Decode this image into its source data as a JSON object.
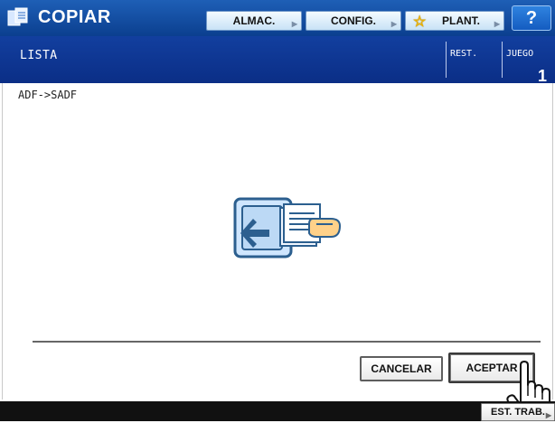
{
  "header": {
    "title": "COPIAR",
    "buttons": {
      "almac": "ALMAC.",
      "config": "CONFIG.",
      "plant": "PLANT."
    },
    "help_label": "?"
  },
  "status": {
    "state": "LISTA",
    "rest_label": "REST.",
    "juego_label": "JUEGO",
    "juego_value": "1"
  },
  "content": {
    "mode": "ADF->SADF",
    "icon": "document-feeder-icon"
  },
  "actions": {
    "cancel": "CANCELAR",
    "accept": "ACEPTAR"
  },
  "footer": {
    "job_status": "EST. TRAB."
  },
  "colors": {
    "header_blue": "#1e5fb6",
    "status_blue": "#0b2e86",
    "accent_yellow": "#f0b400"
  }
}
